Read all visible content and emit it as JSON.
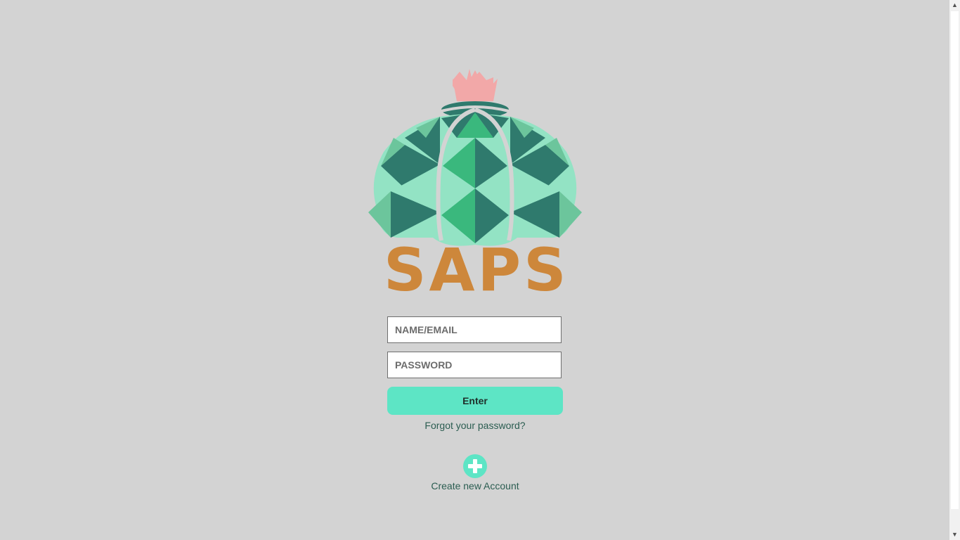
{
  "brand": {
    "name": "SAPS",
    "colors": {
      "background": "#d3d3d3",
      "wordmark": "#cd873b",
      "accent": "#5de5c5",
      "link": "#2b5d51",
      "crown": "#f2a8a8",
      "dark_green": "#2f7a6d",
      "mid_green": "#3ab87d",
      "light_green": "#93e3c4"
    }
  },
  "login": {
    "name_placeholder": "NAME/EMAIL",
    "password_placeholder": "PASSWORD",
    "enter_label": "Enter",
    "forgot_label": "Forgot your password?",
    "create_label": "Create new Account"
  },
  "icons": {
    "create": "plus-circle-icon",
    "logo": "cactus-crown-logo"
  }
}
